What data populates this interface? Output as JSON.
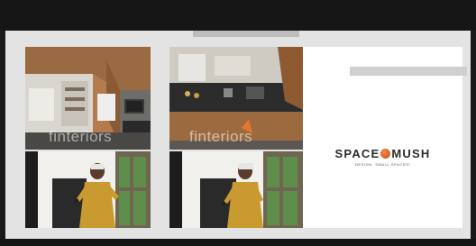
{
  "brand": {
    "name_part1": "SPACE",
    "name_part2": "MUSH",
    "tagline": "DESIGN. SMALL SPACES!",
    "dot_color": "#e0601f"
  },
  "panels": {
    "top_left": {
      "watermark": "finteriors"
    },
    "top_right": {
      "watermark": "finteriors"
    }
  },
  "colors": {
    "slide_background": "#e3e3e3",
    "window_chrome": "#161616",
    "accent_orange": "#e0601f"
  }
}
